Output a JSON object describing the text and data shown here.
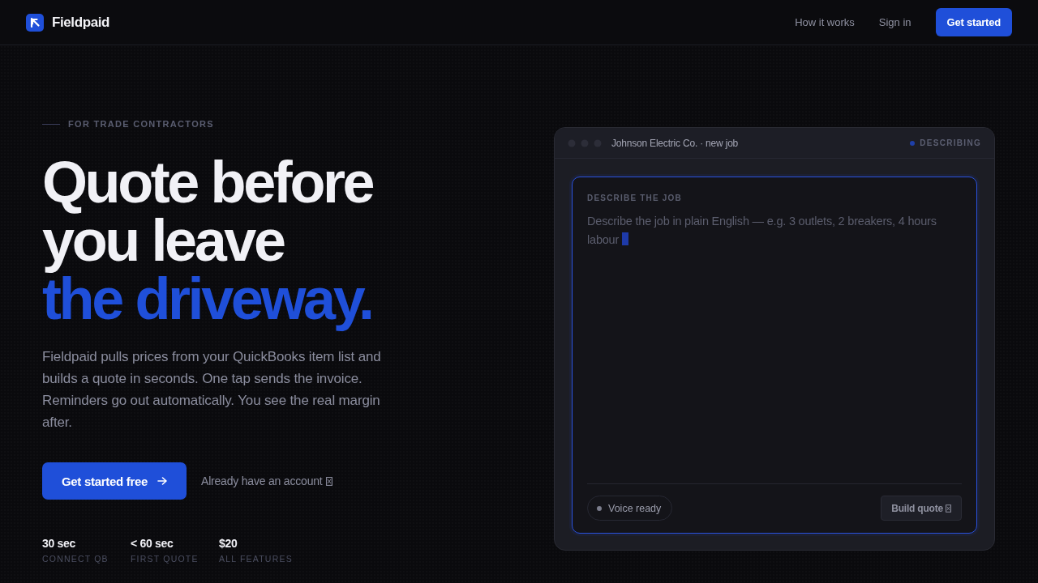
{
  "nav": {
    "brand": "Fieldpaid",
    "items": [
      {
        "kind": "link",
        "label": "How it works"
      },
      {
        "kind": "link",
        "label": "Sign in"
      },
      {
        "kind": "button",
        "label": "Get started"
      }
    ]
  },
  "hero": {
    "eyebrow": "FOR TRADE CONTRACTORS",
    "headline": "Quote before you leave",
    "headline_accent": "the driveway.",
    "description": "Fieldpaid pulls prices from your QuickBooks item list and builds a quote in seconds. One tap sends the invoice. Reminders go out automatically. You see the real margin after.",
    "actions": [
      {
        "kind": "primary",
        "label": "Get started free"
      },
      {
        "kind": "link",
        "label": "Already have an account"
      }
    ],
    "stats": [
      {
        "value": "30 sec",
        "label": "CONNECT QB"
      },
      {
        "value": "< 60 sec",
        "label": "FIRST QUOTE"
      },
      {
        "value": "$20",
        "label": "ALL FEATURES"
      }
    ]
  },
  "job_card": {
    "title": "Johnson Electric Co. · new job",
    "status": "DESCRIBING",
    "field": {
      "label": "DESCRIBE THE JOB",
      "placeholder": "Describe the job in plain English — e.g. 3 outlets, 2 breakers, 4 hours labour",
      "focused": true
    },
    "voice": "Voice ready",
    "submit": "Build quote"
  }
}
